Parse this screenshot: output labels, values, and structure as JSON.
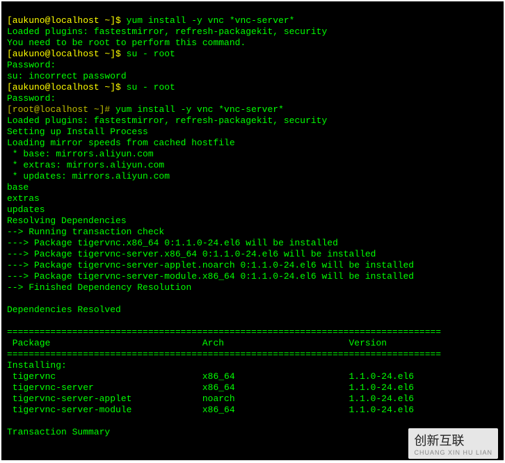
{
  "prompt1_user": "[aukuno@localhost ~]$ ",
  "prompt1_cmd": "yum install -y vnc *vnc-server*",
  "line2": "Loaded plugins: fastestmirror, refresh-packagekit, security",
  "line3": "You need to be root to perform this command.",
  "prompt2_user": "[aukuno@localhost ~]$ ",
  "prompt2_cmd": "su - root",
  "line5": "Password: ",
  "line6": "su: incorrect password",
  "prompt3_user": "[aukuno@localhost ~]$ ",
  "prompt3_cmd": "su - root",
  "line8": "Password: ",
  "prompt4_root": "[root@localhost ~]# ",
  "prompt4_cmd": "yum install -y vnc *vnc-server*",
  "line10": "Loaded plugins: fastestmirror, refresh-packagekit, security",
  "line11": "Setting up Install Process",
  "line12": "Loading mirror speeds from cached hostfile",
  "line13": " * base: mirrors.aliyun.com",
  "line14": " * extras: mirrors.aliyun.com",
  "line15": " * updates: mirrors.aliyun.com",
  "line16": "base",
  "line17": "extras",
  "line18": "updates",
  "line19": "Resolving Dependencies",
  "line20": "--> Running transaction check",
  "line21": "---> Package tigervnc.x86_64 0:1.1.0-24.el6 will be installed",
  "line22": "---> Package tigervnc-server.x86_64 0:1.1.0-24.el6 will be installed",
  "line23": "---> Package tigervnc-server-applet.noarch 0:1.1.0-24.el6 will be installed",
  "line24": "---> Package tigervnc-server-module.x86_64 0:1.1.0-24.el6 will be installed",
  "line25": "--> Finished Dependency Resolution",
  "line26": "",
  "line27": "Dependencies Resolved",
  "line28": "",
  "sep1": "================================================================================",
  "hdr": " Package                            Arch                       Version",
  "sep2": "================================================================================",
  "inst": "Installing:",
  "pkg1": " tigervnc                           x86_64                     1.1.0-24.el6",
  "pkg2": " tigervnc-server                    x86_64                     1.1.0-24.el6",
  "pkg3": " tigervnc-server-applet             noarch                     1.1.0-24.el6",
  "pkg4": " tigervnc-server-module             x86_64                     1.1.0-24.el6",
  "line_blank2": "",
  "summary": "Transaction Summary",
  "watermark_main": "创新互联",
  "watermark_sub": "CHUANG XIN HU LIAN"
}
